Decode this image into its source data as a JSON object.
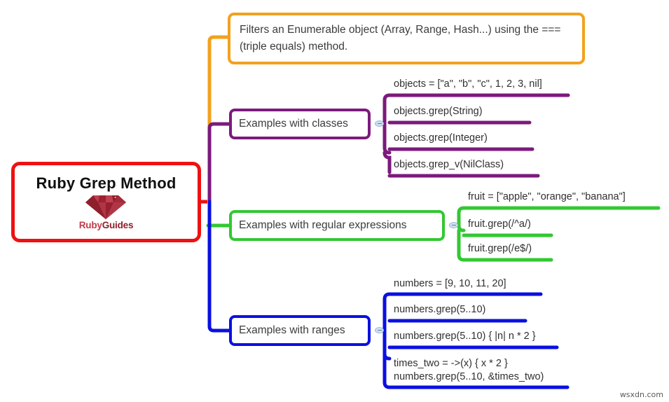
{
  "watermark": "wsxdn.com",
  "colors": {
    "root": "#ee1111",
    "description": "#f2a21e",
    "classes": "#7c1a7c",
    "regex": "#32c832",
    "ranges": "#0a10e0"
  },
  "root": {
    "title": "Ruby Grep Method",
    "logo_ruby": "Ruby",
    "logo_guides": "Guides"
  },
  "description": {
    "text": "Filters an Enumerable object (Array, Range, Hash...) using the === (triple equals) method."
  },
  "branches": [
    {
      "id": "classes",
      "label": "Examples with classes",
      "items": [
        {
          "lines": [
            "objects = [\"a\", \"b\", \"c\", 1, 2, 3, nil]"
          ]
        },
        {
          "lines": [
            "objects.grep(String)"
          ]
        },
        {
          "lines": [
            "objects.grep(Integer)"
          ]
        },
        {
          "lines": [
            "objects.grep_v(NilClass)"
          ]
        }
      ]
    },
    {
      "id": "regex",
      "label": "Examples with regular expressions",
      "items": [
        {
          "lines": [
            "fruit = [\"apple\", \"orange\", \"banana\"]"
          ]
        },
        {
          "lines": [
            "fruit.grep(/^a/)"
          ]
        },
        {
          "lines": [
            "fruit.grep(/e$/)"
          ]
        }
      ]
    },
    {
      "id": "ranges",
      "label": "Examples with ranges",
      "items": [
        {
          "lines": [
            "numbers = [9, 10, 11, 20]"
          ]
        },
        {
          "lines": [
            "numbers.grep(5..10)"
          ]
        },
        {
          "lines": [
            "numbers.grep(5..10) { |n| n * 2 }"
          ]
        },
        {
          "lines": [
            "times_two = ->(x) { x * 2 }",
            "numbers.grep(5..10, &times_two)"
          ]
        }
      ]
    }
  ]
}
